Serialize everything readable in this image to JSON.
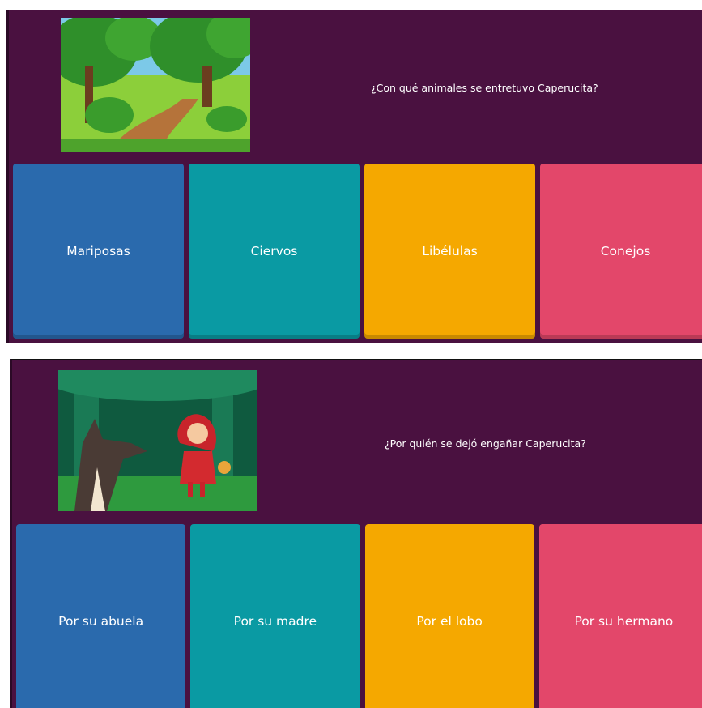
{
  "colors": {
    "background": "#4a1140",
    "answer_blue": "#2a6aad",
    "answer_teal": "#0a9aa3",
    "answer_yellow": "#f5a800",
    "answer_red": "#e3476a"
  },
  "questions": [
    {
      "image_icon": "forest-path-illustration",
      "text": "¿Con qué animales se entretuvo Caperucita?",
      "answers": [
        "Mariposas",
        "Ciervos",
        "Libélulas",
        "Conejos"
      ]
    },
    {
      "image_icon": "red-riding-hood-wolf-illustration",
      "text": "¿Por quién se dejó engañar Caperucita?",
      "answers": [
        "Por su abuela",
        "Por su madre",
        "Por el lobo",
        "Por su hermano"
      ]
    }
  ]
}
